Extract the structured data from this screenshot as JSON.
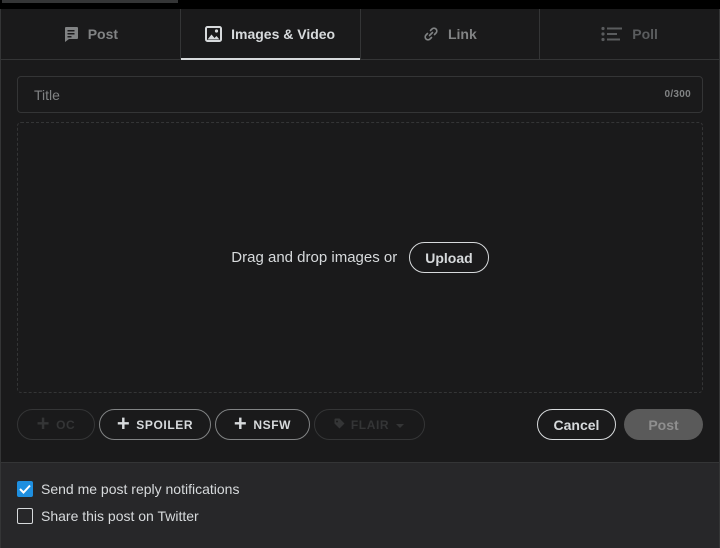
{
  "tabs": [
    {
      "label": "Post",
      "icon": "post-icon",
      "state": "normal"
    },
    {
      "label": "Images & Video",
      "icon": "image-icon",
      "state": "active"
    },
    {
      "label": "Link",
      "icon": "link-icon",
      "state": "normal"
    },
    {
      "label": "Poll",
      "icon": "poll-icon",
      "state": "disabled"
    }
  ],
  "title_field": {
    "placeholder": "Title",
    "value": "",
    "counter": "0/300"
  },
  "dropzone": {
    "text": "Drag and drop images or",
    "upload_label": "Upload"
  },
  "tags": {
    "oc": {
      "label": "OC",
      "enabled": false
    },
    "spoiler": {
      "label": "SPOILER",
      "enabled": true
    },
    "nsfw": {
      "label": "NSFW",
      "enabled": true
    },
    "flair": {
      "label": "FLAIR",
      "enabled": false
    }
  },
  "actions": {
    "cancel_label": "Cancel",
    "post_label": "Post"
  },
  "options": [
    {
      "label": "Send me post reply notifications",
      "checked": true
    },
    {
      "label": "Share this post on Twitter",
      "checked": false
    }
  ],
  "colors": {
    "background": "#1a1a1b",
    "footer": "#272729",
    "checkbox_accent": "#1e8fe0",
    "border": "#343536"
  }
}
